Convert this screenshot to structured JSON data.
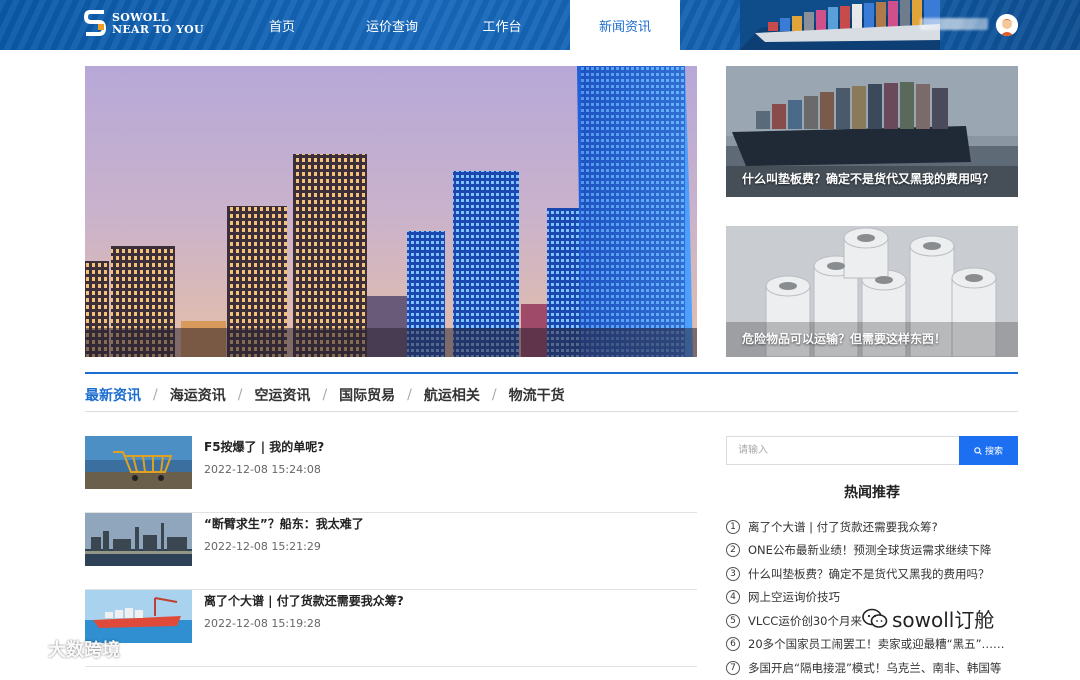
{
  "header": {
    "logo_line1": "SOWOLL",
    "logo_line2": "NEAR TO YOU",
    "nav": [
      {
        "label": "首页"
      },
      {
        "label": "运价查询"
      },
      {
        "label": "工作台"
      },
      {
        "label": "新闻资讯",
        "active": true
      }
    ],
    "active_color": "#1c6dd0"
  },
  "side_cards": [
    {
      "caption": "什么叫垫板费？确定不是货代又黑我的费用吗？"
    },
    {
      "caption": "危险物品可以运输？但需要这样东西！"
    }
  ],
  "tabs": [
    "最新资讯",
    "海运资讯",
    "空运资讯",
    "国际贸易",
    "航运相关",
    "物流干货"
  ],
  "tab_separator": "/",
  "news": [
    {
      "title": "F5按爆了 | 我的单呢?",
      "time": "2022-12-08 15:24:08",
      "thumb": "shopping-cart-photo"
    },
    {
      "title": "“断臂求生”？船东：我太难了",
      "time": "2022-12-08 15:21:29",
      "thumb": "industrial-port-photo"
    },
    {
      "title": "离了个大谱 | 付了货款还需要我众筹?",
      "time": "2022-12-08 15:19:28",
      "thumb": "cargo-ship-photo"
    }
  ],
  "search": {
    "placeholder": "请输入",
    "button": "搜索"
  },
  "hot": {
    "title": "热闻推荐",
    "items": [
      {
        "num": "1",
        "text": "离了个大谱 | 付了货款还需要我众筹?"
      },
      {
        "num": "2",
        "text": "ONE公布最新业绩！预测全球货运需求继续下降"
      },
      {
        "num": "3",
        "text": "什么叫垫板费？确定不是货代又黑我的费用吗？"
      },
      {
        "num": "4",
        "text": "网上空运询价技巧"
      },
      {
        "num": "5",
        "text": "VLCC运价创30个月来"
      },
      {
        "num": "6",
        "text": "20多个国家员工闹罢工！卖家或迎最糟“黑五”……"
      },
      {
        "num": "7",
        "text": "多国开启“隔电接混”模式！乌克兰、南非、韩国等"
      }
    ]
  },
  "watermarks": {
    "right": "sowoll订舱",
    "left": "大数跨境"
  }
}
